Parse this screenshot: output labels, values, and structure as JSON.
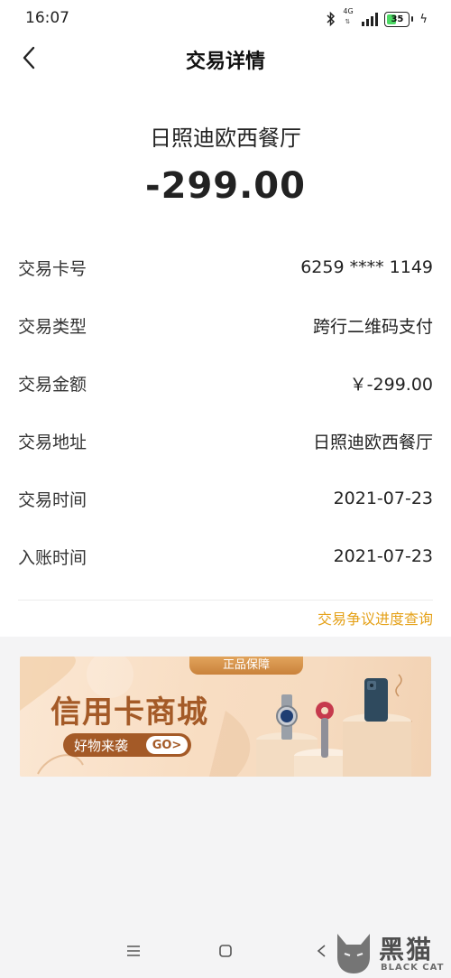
{
  "status_bar": {
    "time": "16:07",
    "network": "4G",
    "battery": "35",
    "icons": [
      "bluetooth-icon",
      "signal-icon",
      "battery-icon",
      "charging-icon"
    ]
  },
  "header": {
    "title": "交易详情",
    "back_icon": "chevron-left-icon"
  },
  "summary": {
    "merchant": "日照迪欧西餐厅",
    "amount": "-299.00"
  },
  "details": [
    {
      "label": "交易卡号",
      "value": "6259 **** 1149"
    },
    {
      "label": "交易类型",
      "value": "跨行二维码支付"
    },
    {
      "label": "交易金额",
      "value": "￥-299.00"
    },
    {
      "label": "交易地址",
      "value": "日照迪欧西餐厅"
    },
    {
      "label": "交易时间",
      "value": "2021-07-23"
    },
    {
      "label": "入账时间",
      "value": "2021-07-23"
    }
  ],
  "dispute_link": "交易争议进度查询",
  "banner": {
    "tag": "正品保障",
    "title": "信用卡商城",
    "subtitle": "好物来袭",
    "go_label": "GO>"
  },
  "watermark": {
    "main": "黑猫",
    "sub": "BLACK CAT"
  },
  "colors": {
    "accent": "#e5a21a",
    "banner_brown": "#a45a27",
    "gray_bg": "#f4f4f5"
  }
}
